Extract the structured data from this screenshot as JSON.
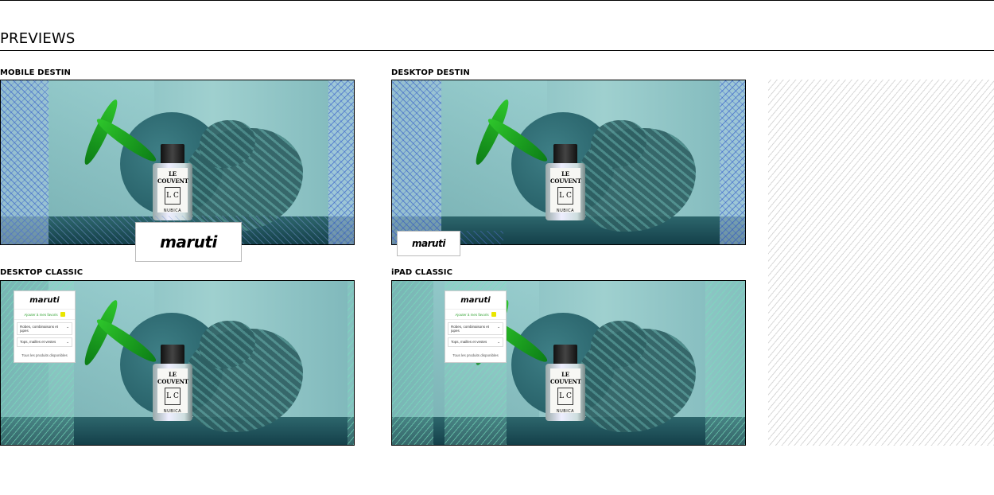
{
  "section": {
    "title": "PREVIEWS"
  },
  "previews": [
    {
      "label": "MOBILE DESTIN"
    },
    {
      "label": "DESKTOP DESTIN"
    },
    {
      "label": "DESKTOP CLASSIC"
    },
    {
      "label": "iPAD CLASSIC"
    }
  ],
  "brand": {
    "logo": "maruti"
  },
  "product": {
    "maker": "LE COUVENT",
    "monogram": "L C",
    "name": "NUBICA"
  },
  "classic_card": {
    "favorite": "Ajouter à mes favoris",
    "select1": "Robes, combinaisons et jupes",
    "select2": "Tops, mailles et vestes",
    "available": "Tous les produits disponibles"
  },
  "colors": {
    "accent_blue": "#2850c8",
    "accent_green": "#78e1be",
    "teal": "#8cc2c4"
  }
}
